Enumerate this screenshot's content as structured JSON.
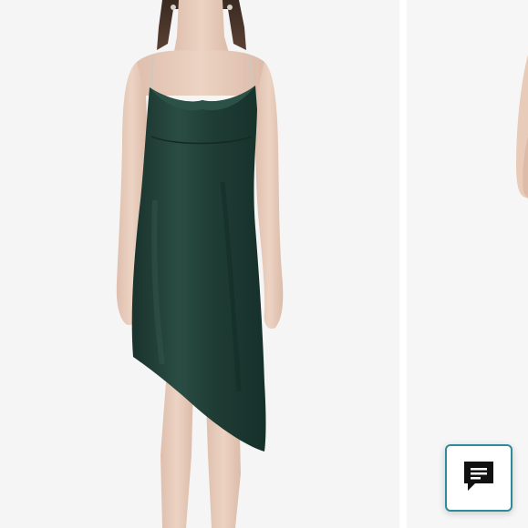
{
  "gallery": {
    "current_image_alt": "",
    "next_image_alt": ""
  },
  "chat_widget": {
    "label": "",
    "icon": "chat-bubble-icon",
    "border_color": "#2e8b9a",
    "icon_color": "#111111"
  },
  "colors": {
    "background": "#f5f5f5",
    "dress": "#1f3d35",
    "skin": "#e9cdbc"
  }
}
